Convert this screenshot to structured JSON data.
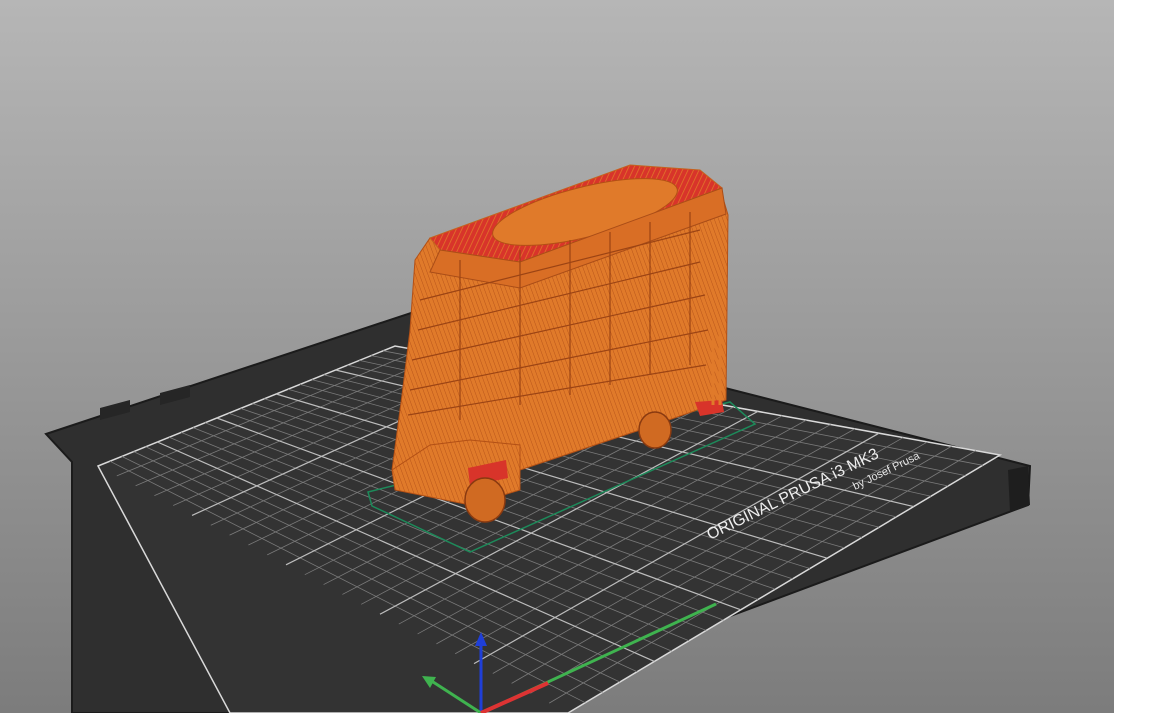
{
  "viewport": {
    "label": "3D view",
    "background_top": "#b6b6b6",
    "background_bottom": "#7c7c7c"
  },
  "bed": {
    "brand_line": "ORIGINAL PRUSA i3  MK3",
    "byline": "by Josef Prusa",
    "plate_color": "#2e2e2e",
    "grid_color": "#8a8a8a"
  },
  "model": {
    "name": "double-decker bus (sliced preview)",
    "color": "#e07a2a",
    "top_color": "#d8342a"
  },
  "axes": {
    "x_color": "#3fb34f",
    "y_color": "#d33",
    "z_color": "#1f3fd8"
  }
}
